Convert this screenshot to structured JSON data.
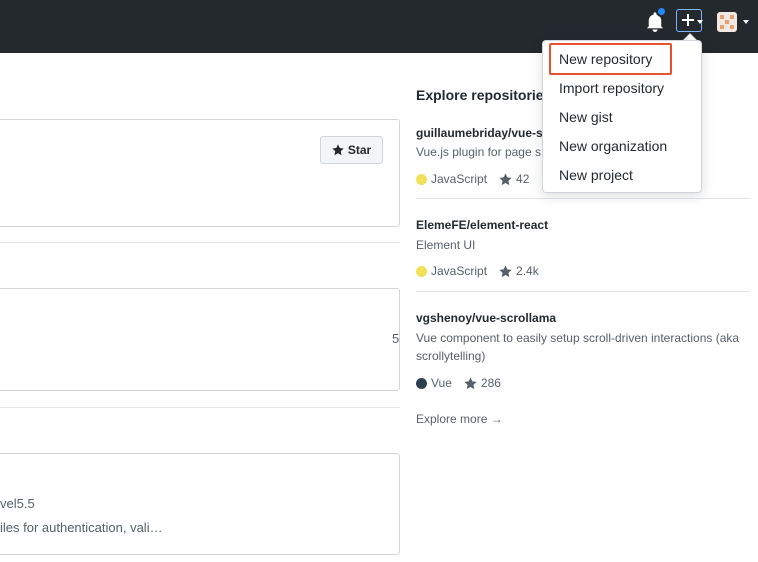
{
  "header": {
    "notifications_icon": "bell-icon",
    "create_icon": "plus-icon",
    "colors": {
      "background": "#24292e",
      "notification_dot": "#2188ff"
    }
  },
  "create_menu": {
    "items": [
      {
        "label": "New repository",
        "highlighted": true
      },
      {
        "label": "Import repository"
      },
      {
        "label": "New gist"
      },
      {
        "label": "New organization"
      },
      {
        "label": "New project"
      }
    ],
    "highlight_color": "#e8522d"
  },
  "feed": {
    "star_button_label": "Star",
    "card2_fragment": "5",
    "card3_fragment_1": "vel5.5",
    "card3_fragment_2": "iles for authentication, vali…"
  },
  "explore": {
    "title": "Explore repositorie",
    "repos": [
      {
        "name": "guillaumebriday/vue-s",
        "description": "Vue.js plugin for page s",
        "language": "JavaScript",
        "language_color": "#f1e05a",
        "stars": "42"
      },
      {
        "name": "ElemeFE/element-react",
        "description": "Element UI",
        "language": "JavaScript",
        "language_color": "#f1e05a",
        "stars": "2.4k"
      },
      {
        "name": "vgshenoy/vue-scrollama",
        "description": "Vue component to easily setup scroll-driven interactions (aka scrollytelling)",
        "language": "Vue",
        "language_color": "#2c3e50",
        "stars": "286"
      }
    ],
    "more_label": "Explore more →"
  }
}
